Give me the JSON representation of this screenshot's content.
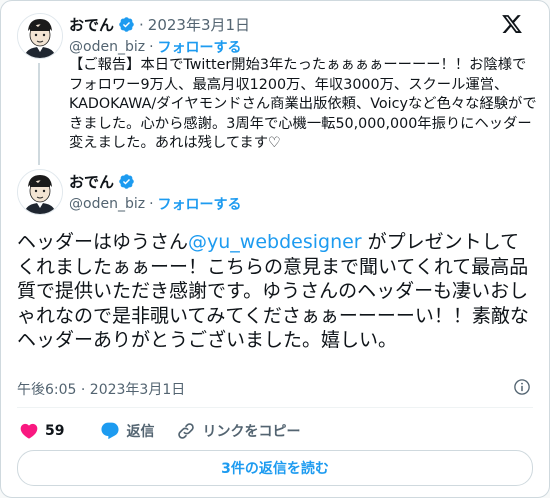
{
  "quoted_tweet": {
    "author_name": "おでん",
    "date": "2023年3月1日",
    "separator": "·",
    "handle": "@oden_biz",
    "follow_label": "フォローする",
    "text": "【ご報告】本日でTwitter開始3年たったぁぁぁぁーーーー！！お陰様でフォロワー9万人、最高月収1200万、年収3000万、スクール運営、KADOKAWA/ダイヤモンドさん商業出版依頼、Voicyなど色々な経験ができました。心から感謝。3周年で心機一転50,000,000年振りにヘッダー変えました。あれは残してます♡"
  },
  "main_tweet": {
    "author_name": "おでん",
    "handle": "@oden_biz",
    "separator": "·",
    "follow_label": "フォローする",
    "text_before": "ヘッダーはゆうさん",
    "mention": "@yu_webdesigner",
    "text_after": " がプレゼントしてくれましたぁぁーー！こちらの意見まで聞いてくれて最高品質で提供いただき感謝です。ゆうさんのヘッダーも凄いおしゃれなので是非覗いてみてくださぁぁーーーーい！！素敵なヘッダーありがとうございました。嬉しい。",
    "timestamp": "午後6:05 · 2023年3月1日"
  },
  "actions": {
    "like_count": "59",
    "reply_label": "返信",
    "copy_link_label": "リンクをコピー"
  },
  "read_replies_label": "3件の返信を読む",
  "colors": {
    "accent": "#1d9bf0",
    "like": "#f91880",
    "text": "#0f1419",
    "muted": "#536471"
  }
}
